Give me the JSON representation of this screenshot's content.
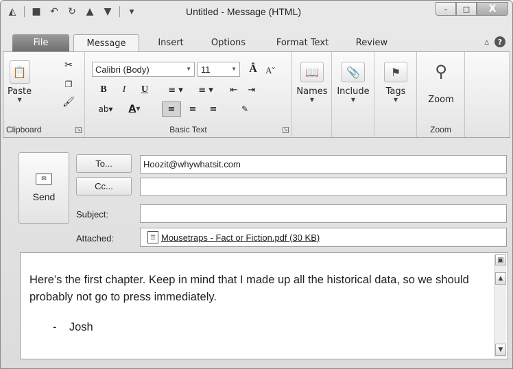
{
  "window": {
    "title": "Untitled - Message (HTML)",
    "minimize": "–",
    "maximize": "□",
    "close": "X"
  },
  "tabs": [
    {
      "label": "File"
    },
    {
      "label": "Message"
    },
    {
      "label": "Insert"
    },
    {
      "label": "Options"
    },
    {
      "label": "Format Text"
    },
    {
      "label": "Review"
    }
  ],
  "tabrow": {
    "help": "?",
    "collapse": "▵"
  },
  "ribbon": {
    "clipboard": {
      "paste": "Paste",
      "group": "Clipboard"
    },
    "basic_text": {
      "font": "Calibri (Body)",
      "size": "11",
      "bold": "B",
      "italic": "I",
      "underline": "U",
      "font_color": "A",
      "group": "Basic Text"
    },
    "names": {
      "label": "Names"
    },
    "include": {
      "label": "Include"
    },
    "tags": {
      "label": "Tags"
    },
    "zoom": {
      "label": "Zoom",
      "group": "Zoom"
    }
  },
  "compose": {
    "send": "Send",
    "to_button": "To...",
    "cc_button": "Cc...",
    "subject_label": "Subject:",
    "attached_label": "Attached:",
    "to_value": "Hoozit@whywhatsit.com",
    "cc_value": "",
    "subject_value": "",
    "attachment": "Mousetraps - Fact or Fiction.pdf (30 KB)"
  },
  "message": {
    "body": "Here’s the first chapter. Keep in mind that I made up all the historical data, so we should probably not go to press immediately.",
    "signature": "-    Josh"
  }
}
